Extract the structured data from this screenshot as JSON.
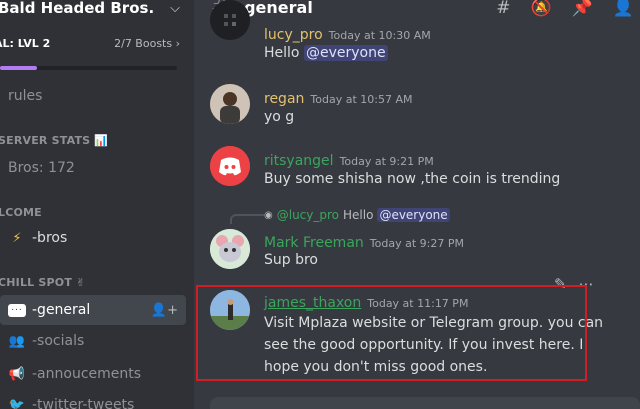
{
  "server": {
    "name": "Bald Headed Bros.",
    "boost_level": "AL: LVL 2",
    "boost_count": "2/7 Boosts",
    "boost_progress": 0.21
  },
  "sidebar": {
    "rules": "rules",
    "cat_stats": "SERVER STATS 📊",
    "bros": "Bros: 172",
    "cat_welcome": "LCOME",
    "bros_channel": "-bros",
    "cat_chill": "CHILL SPOT ✌",
    "general": "-general",
    "socials": "-socials",
    "announcements": "-annoucements",
    "twitter": "-twitter-tweets"
  },
  "topbar": {
    "channel": "-general"
  },
  "messages": [
    {
      "author": "lucy_pro",
      "color": "#e3c16f",
      "time": "Today at 10:30 AM",
      "text": "Hello",
      "mention": "@everyone"
    },
    {
      "author": "regan",
      "color": "#e3c16f",
      "time": "Today at 10:57 AM",
      "text": "yo g"
    },
    {
      "author": "ritsyangel",
      "color": "#3ba55d",
      "time": "Today at 9:21 PM",
      "text": "Buy some shisha now ,the coin is trending"
    },
    {
      "author": "Mark Freeman",
      "color": "#3ba55d",
      "time": "Today at 9:27 PM",
      "text": "Sup bro",
      "reply_author": "@lucy_pro",
      "reply_text": "Hello",
      "reply_mention": "@everyone"
    },
    {
      "author": "james_thaxon",
      "color": "#3ba55d",
      "time": "Today at 11:17 PM",
      "text_lines": [
        "Visit Mplaza website or Telegram group. you can",
        "see the good opportunity. If you invest here.  I",
        "hope you don't miss good ones."
      ]
    }
  ]
}
